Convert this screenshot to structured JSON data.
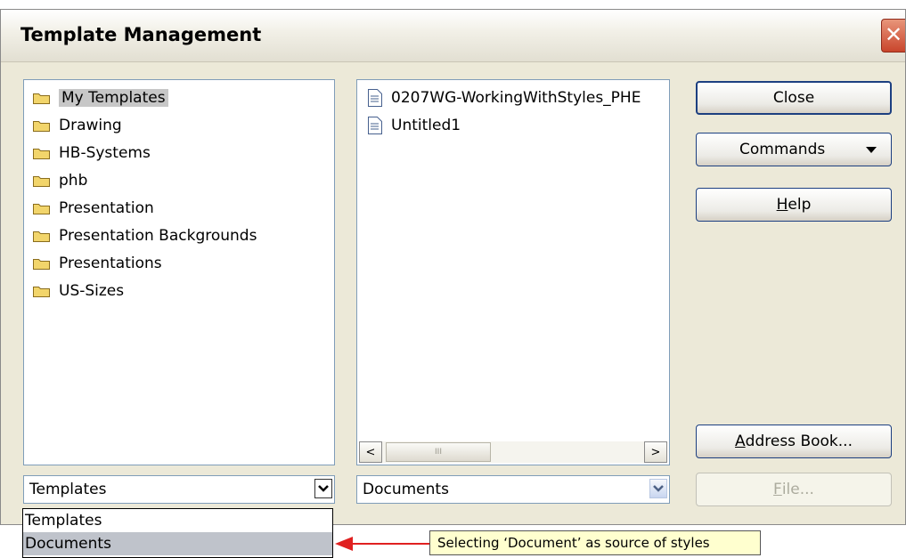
{
  "window": {
    "title": "Template Management",
    "close_glyph": "✕"
  },
  "categories": {
    "items": [
      {
        "label": "My Templates",
        "selected": true
      },
      {
        "label": "Drawing"
      },
      {
        "label": "HB-Systems"
      },
      {
        "label": "phb"
      },
      {
        "label": "Presentation"
      },
      {
        "label": "Presentation Backgrounds"
      },
      {
        "label": "Presentations"
      },
      {
        "label": "US-Sizes"
      }
    ],
    "source_value": "Templates"
  },
  "documents": {
    "items": [
      {
        "label": "0207WG-WorkingWithStyles_PHE"
      },
      {
        "label": "Untitled1"
      }
    ],
    "source_value": "Documents",
    "scroll_left": "<",
    "scroll_right": ">",
    "thumb_grip": "III"
  },
  "buttons": {
    "close": "Close",
    "commands": "Commands",
    "help": "Help",
    "address_book": "Address Book...",
    "file": "File..."
  },
  "dropdown_list": {
    "options": [
      "Templates",
      "Documents"
    ],
    "highlighted": "Documents"
  },
  "callout": {
    "text": "Selecting ‘Document’ as source of styles"
  },
  "colors": {
    "arrow": "#e02020",
    "selection": "#c7c7c7",
    "folder": "#f2d56b"
  }
}
